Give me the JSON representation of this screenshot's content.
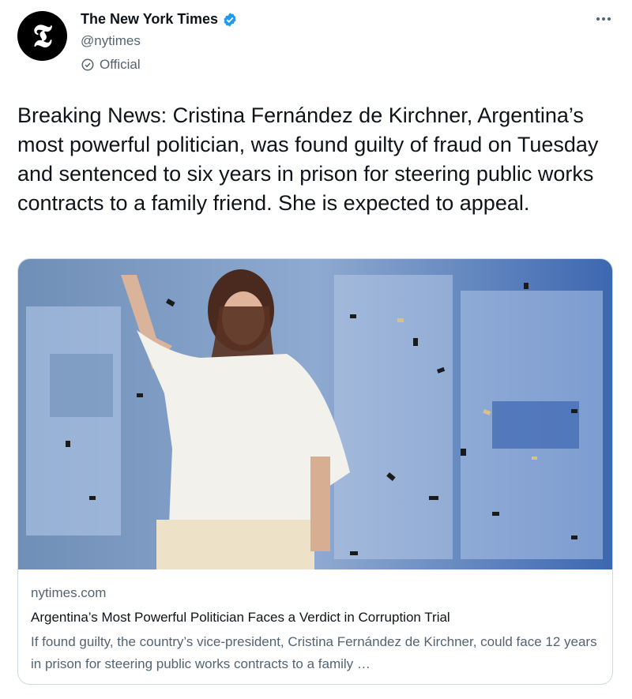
{
  "author": {
    "name": "The New York Times",
    "handle": "@nytimes",
    "label": "Official",
    "avatar_glyph": "𝕿",
    "verified_color": "#1d9bf0"
  },
  "tweet": {
    "text": "Breaking News: Cristina Fernández de Kirchner, Argentina’s most powerful politician, was found guilty of fraud on Tuesday and sentenced to six years in prison for steering public works contracts to a family friend. She is expected to appeal."
  },
  "card": {
    "domain": "nytimes.com",
    "title": "Argentina’s Most Powerful Politician Faces a Verdict in Corruption Trial",
    "description": "If found guilty, the country’s vice-president, Cristina Fernández de Kirchner, could face 12 years in prison for steering public works contracts to a family …"
  },
  "icons": {
    "more": "more-options-icon",
    "verified": "verified-badge-icon",
    "official": "official-check-icon"
  },
  "colors": {
    "text": "#0f1419",
    "secondary": "#536471",
    "border": "#cfd9de"
  }
}
